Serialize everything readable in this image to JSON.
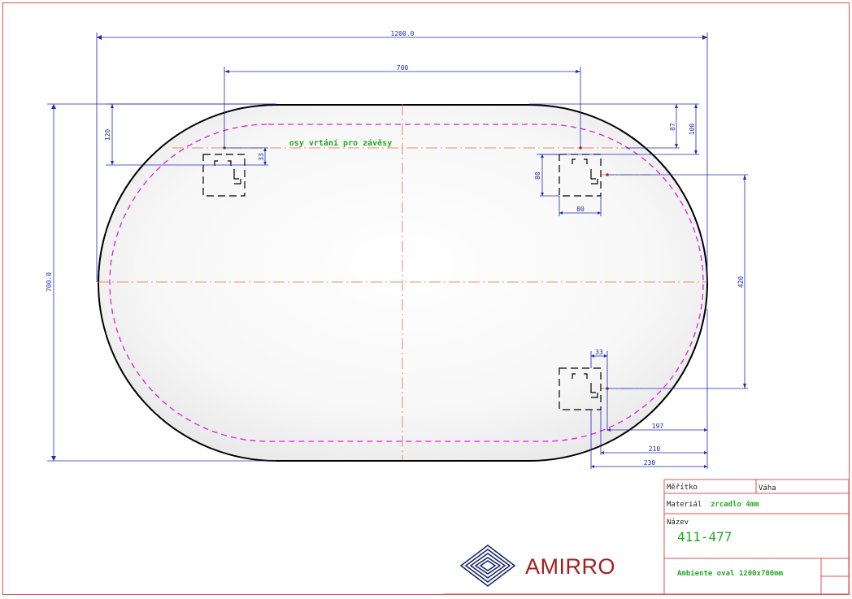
{
  "drawing": {
    "dimensions": {
      "overall_width": "1200.0",
      "overall_height": "700.0",
      "hole_spacing": "700",
      "top_offset_left": "120",
      "top_offset_87": "87",
      "top_offset_100": "100",
      "hole_drop": "33",
      "hanger_height": "80",
      "hanger_width": "80",
      "vertical_spacing": "420",
      "bottom_hanger_33": "33",
      "edge_197": "197",
      "edge_210": "210",
      "edge_230": "230"
    },
    "annotation": "osy vrtání pro závěsy"
  },
  "title_block": {
    "scale_label": "Měřítko",
    "weight_label": "Váha",
    "material_label": "Materiál",
    "material_value": "zrcadlo 4mm",
    "name_label": "Název",
    "part_number": "411-477",
    "description": "Ambiente oval 1200x700mm"
  },
  "brand": {
    "name": "AMIRRO"
  },
  "colors": {
    "frame": "#e05050",
    "dimension": "#1c2bb0",
    "outline": "#000000",
    "inner_line": "#e020e0",
    "axis": "#e07040",
    "annotation": "#22aa22",
    "brand": "#a51d1f",
    "logo": "#1a2a6c"
  }
}
